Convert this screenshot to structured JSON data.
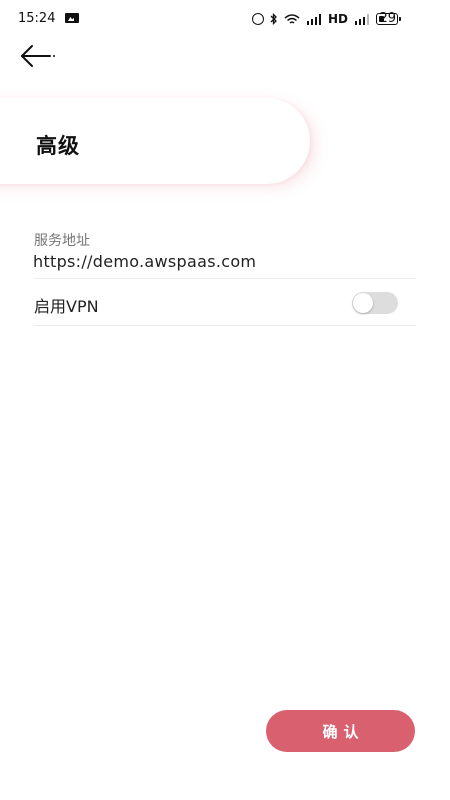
{
  "status_bar": {
    "time": "15:24",
    "network_label": "HD",
    "battery_level": "29"
  },
  "header": {
    "back_icon": "arrow-left-icon",
    "title": "高级"
  },
  "form": {
    "service_address": {
      "label": "服务地址",
      "value": "https://demo.awspaas.com"
    },
    "vpn": {
      "label": "启用VPN",
      "enabled": false
    }
  },
  "footer": {
    "confirm_label": "确认"
  },
  "colors": {
    "accent": "#d9606f",
    "toggle_off": "#dddddd"
  }
}
